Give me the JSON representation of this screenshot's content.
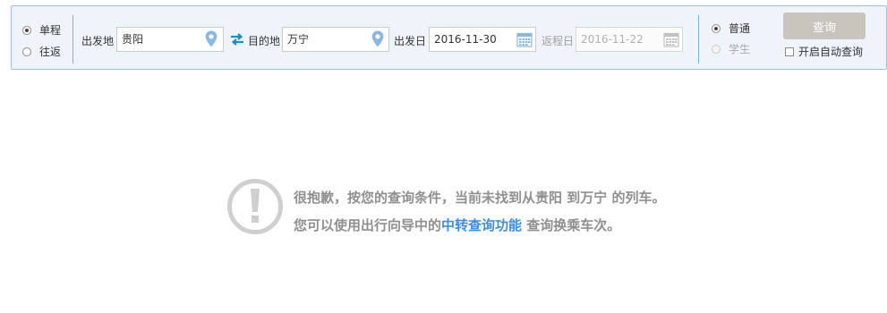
{
  "trip_type": {
    "one_way": "单程",
    "round_trip": "往返",
    "selected": "one_way"
  },
  "from": {
    "label": "出发地",
    "value": "贵阳",
    "icon": "location-pin-icon"
  },
  "swap_icon": "swap-arrows-icon",
  "to": {
    "label": "目的地",
    "value": "万宁",
    "icon": "location-pin-icon"
  },
  "depart": {
    "label": "出发日",
    "value": "2016-11-30",
    "icon": "calendar-icon"
  },
  "return": {
    "label": "返程日",
    "value": "2016-11-22",
    "icon": "calendar-icon",
    "disabled": true
  },
  "passenger_type": {
    "normal": "普通",
    "student": "学生",
    "selected": "normal",
    "student_disabled": true
  },
  "search_button": "查询",
  "auto_query": {
    "label": "开启自动查询",
    "checked": false
  },
  "notice": {
    "icon": "exclamation-circle-icon",
    "text_before": "很抱歉，按您的查询条件，当前未找到从贵阳 到万宁 的列车。您可以使用出行向导中的",
    "link_text": "中转查询功能",
    "text_after": " 查询换乘车次。"
  },
  "colors": {
    "bar_background": "#eef4fa",
    "bar_border": "#9ec2e2",
    "link": "#3d8ee0",
    "notice_text": "#8f8f8f",
    "search_button": "#c9c4bc",
    "swap_icon": "#1f8fc9",
    "pin_icon": "#8ab8de"
  }
}
